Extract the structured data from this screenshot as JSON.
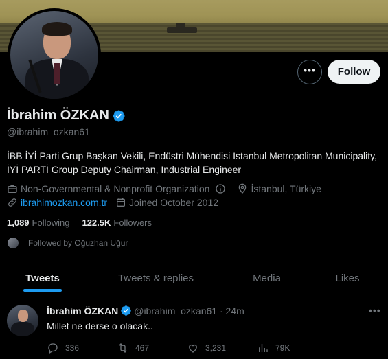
{
  "profile": {
    "name": "İbrahim ÖZKAN",
    "handle": "@ibrahim_ozkan61",
    "bio": "İBB İYİ Parti Grup Başkan Vekili, Endüstri Mühendisi Istanbul Metropolitan Municipality, İYİ PARTİ Group Deputy Chairman, Industrial Engineer",
    "category": "Non-Governmental & Nonprofit Organization",
    "location": "İstanbul, Türkiye",
    "website": "ibrahimozkan.com.tr",
    "joined": "Joined October 2012",
    "following_count": "1,089",
    "following_label": "Following",
    "followers_count": "122.5K",
    "followers_label": "Followers",
    "followed_by": "Followed by Oğuzhan Uğur"
  },
  "buttons": {
    "follow": "Follow",
    "more": "•••"
  },
  "tabs": [
    "Tweets",
    "Tweets & replies",
    "Media",
    "Likes"
  ],
  "tweet": {
    "name": "İbrahim ÖZKAN",
    "handle_time": "@ibrahim_ozkan61 · 24m",
    "text": "Millet ne derse o olacak..",
    "more": "•••",
    "replies": "336",
    "retweets": "467",
    "likes": "3,231",
    "views": "79K"
  },
  "colors": {
    "accent": "#1d9bf0",
    "background": "#000000",
    "muted": "#71767b"
  }
}
